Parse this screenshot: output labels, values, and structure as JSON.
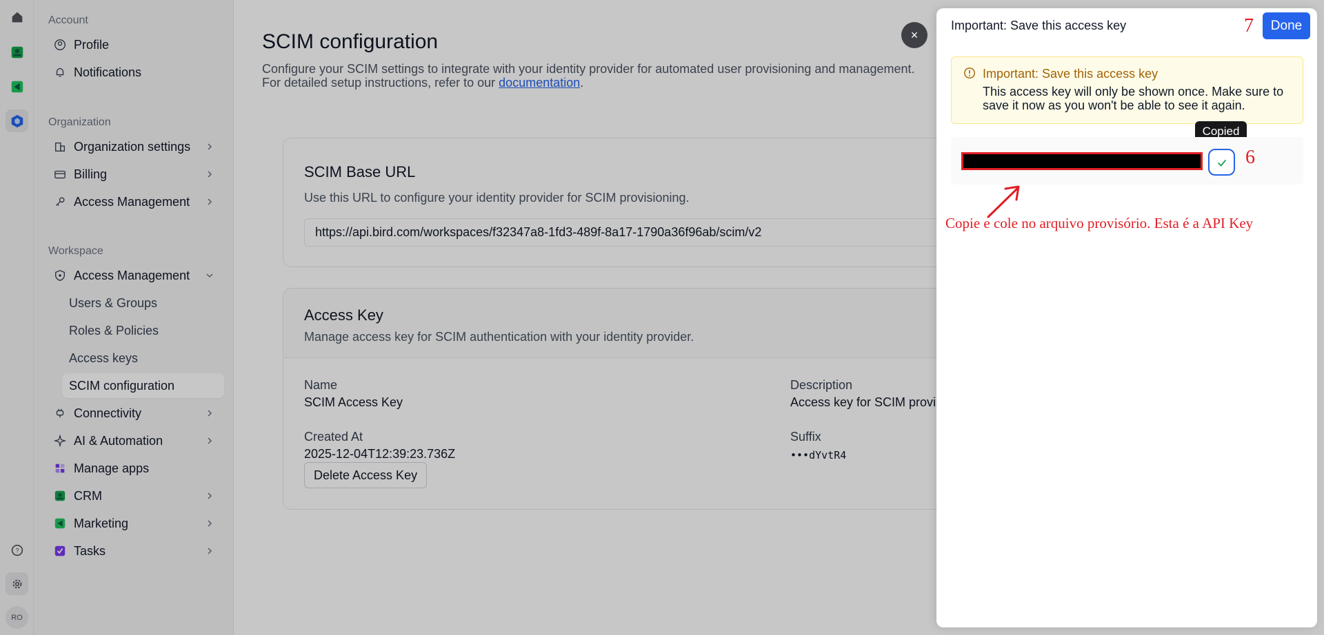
{
  "sidebar": {
    "account_title": "Account",
    "account_items": [
      {
        "label": "Profile",
        "icon": "user-circle-icon"
      },
      {
        "label": "Notifications",
        "icon": "bell-icon"
      }
    ],
    "org_title": "Organization",
    "org_items": [
      {
        "label": "Organization settings",
        "icon": "building-icon"
      },
      {
        "label": "Billing",
        "icon": "credit-card-icon"
      },
      {
        "label": "Access Management",
        "icon": "key-icon"
      }
    ],
    "workspace_title": "Workspace",
    "workspace_access": {
      "label": "Access Management",
      "icon": "shield-icon"
    },
    "access_subitems": [
      "Users & Groups",
      "Roles & Policies",
      "Access keys",
      "SCIM configuration"
    ],
    "workspace_items": [
      {
        "label": "Connectivity",
        "icon": "plug-icon"
      },
      {
        "label": "AI & Automation",
        "icon": "sparkle-icon"
      },
      {
        "label": "Manage apps",
        "icon": "apps-icon"
      },
      {
        "label": "CRM",
        "icon": "crm-icon"
      },
      {
        "label": "Marketing",
        "icon": "marketing-icon"
      },
      {
        "label": "Tasks",
        "icon": "tasks-icon"
      }
    ]
  },
  "rail": {
    "avatar_initials": "RO"
  },
  "main": {
    "title": "SCIM configuration",
    "desc_line1": "Configure your SCIM settings to integrate with your identity provider for automated user provisioning and management.",
    "desc_line2_prefix": "For detailed setup instructions, refer to our ",
    "desc_link": "documentation",
    "desc_line2_suffix": ".",
    "base_url_card": {
      "title": "SCIM Base URL",
      "description": "Use this URL to configure your identity provider for SCIM provisioning.",
      "url": "https://api.bird.com/workspaces/f32347a8-1fd3-489f-8a17-1790a36f96ab/scim/v2"
    },
    "access_key_card": {
      "title": "Access Key",
      "description": "Manage access key for SCIM authentication with your identity provider.",
      "name_label": "Name",
      "name_value": "SCIM Access Key",
      "description_label": "Description",
      "description_value": "Access key for SCIM provisioning",
      "created_label": "Created At",
      "created_value": "2025-12-04T12:39:23.736Z",
      "suffix_label": "Suffix",
      "suffix_value": "•••dYvtR4",
      "delete_button": "Delete Access Key"
    }
  },
  "close_glyph": "×",
  "panel": {
    "title": "Important: Save this access key",
    "done_label": "Done",
    "warning_title": "Important: Save this access key",
    "warning_text": "This access key will only be shown once. Make sure to save it now as you won't be able to see it again.",
    "tooltip": "Copied",
    "annotation_step_done": "7",
    "annotation_step_copy": "6",
    "annotation_text": "Copie e cole no arquivo provisório. Esta é a API Key"
  },
  "colors": {
    "accent": "#2563eb",
    "annotation": "#e11d24",
    "warning_bg": "#fefce8",
    "warning_text": "#a16207"
  }
}
